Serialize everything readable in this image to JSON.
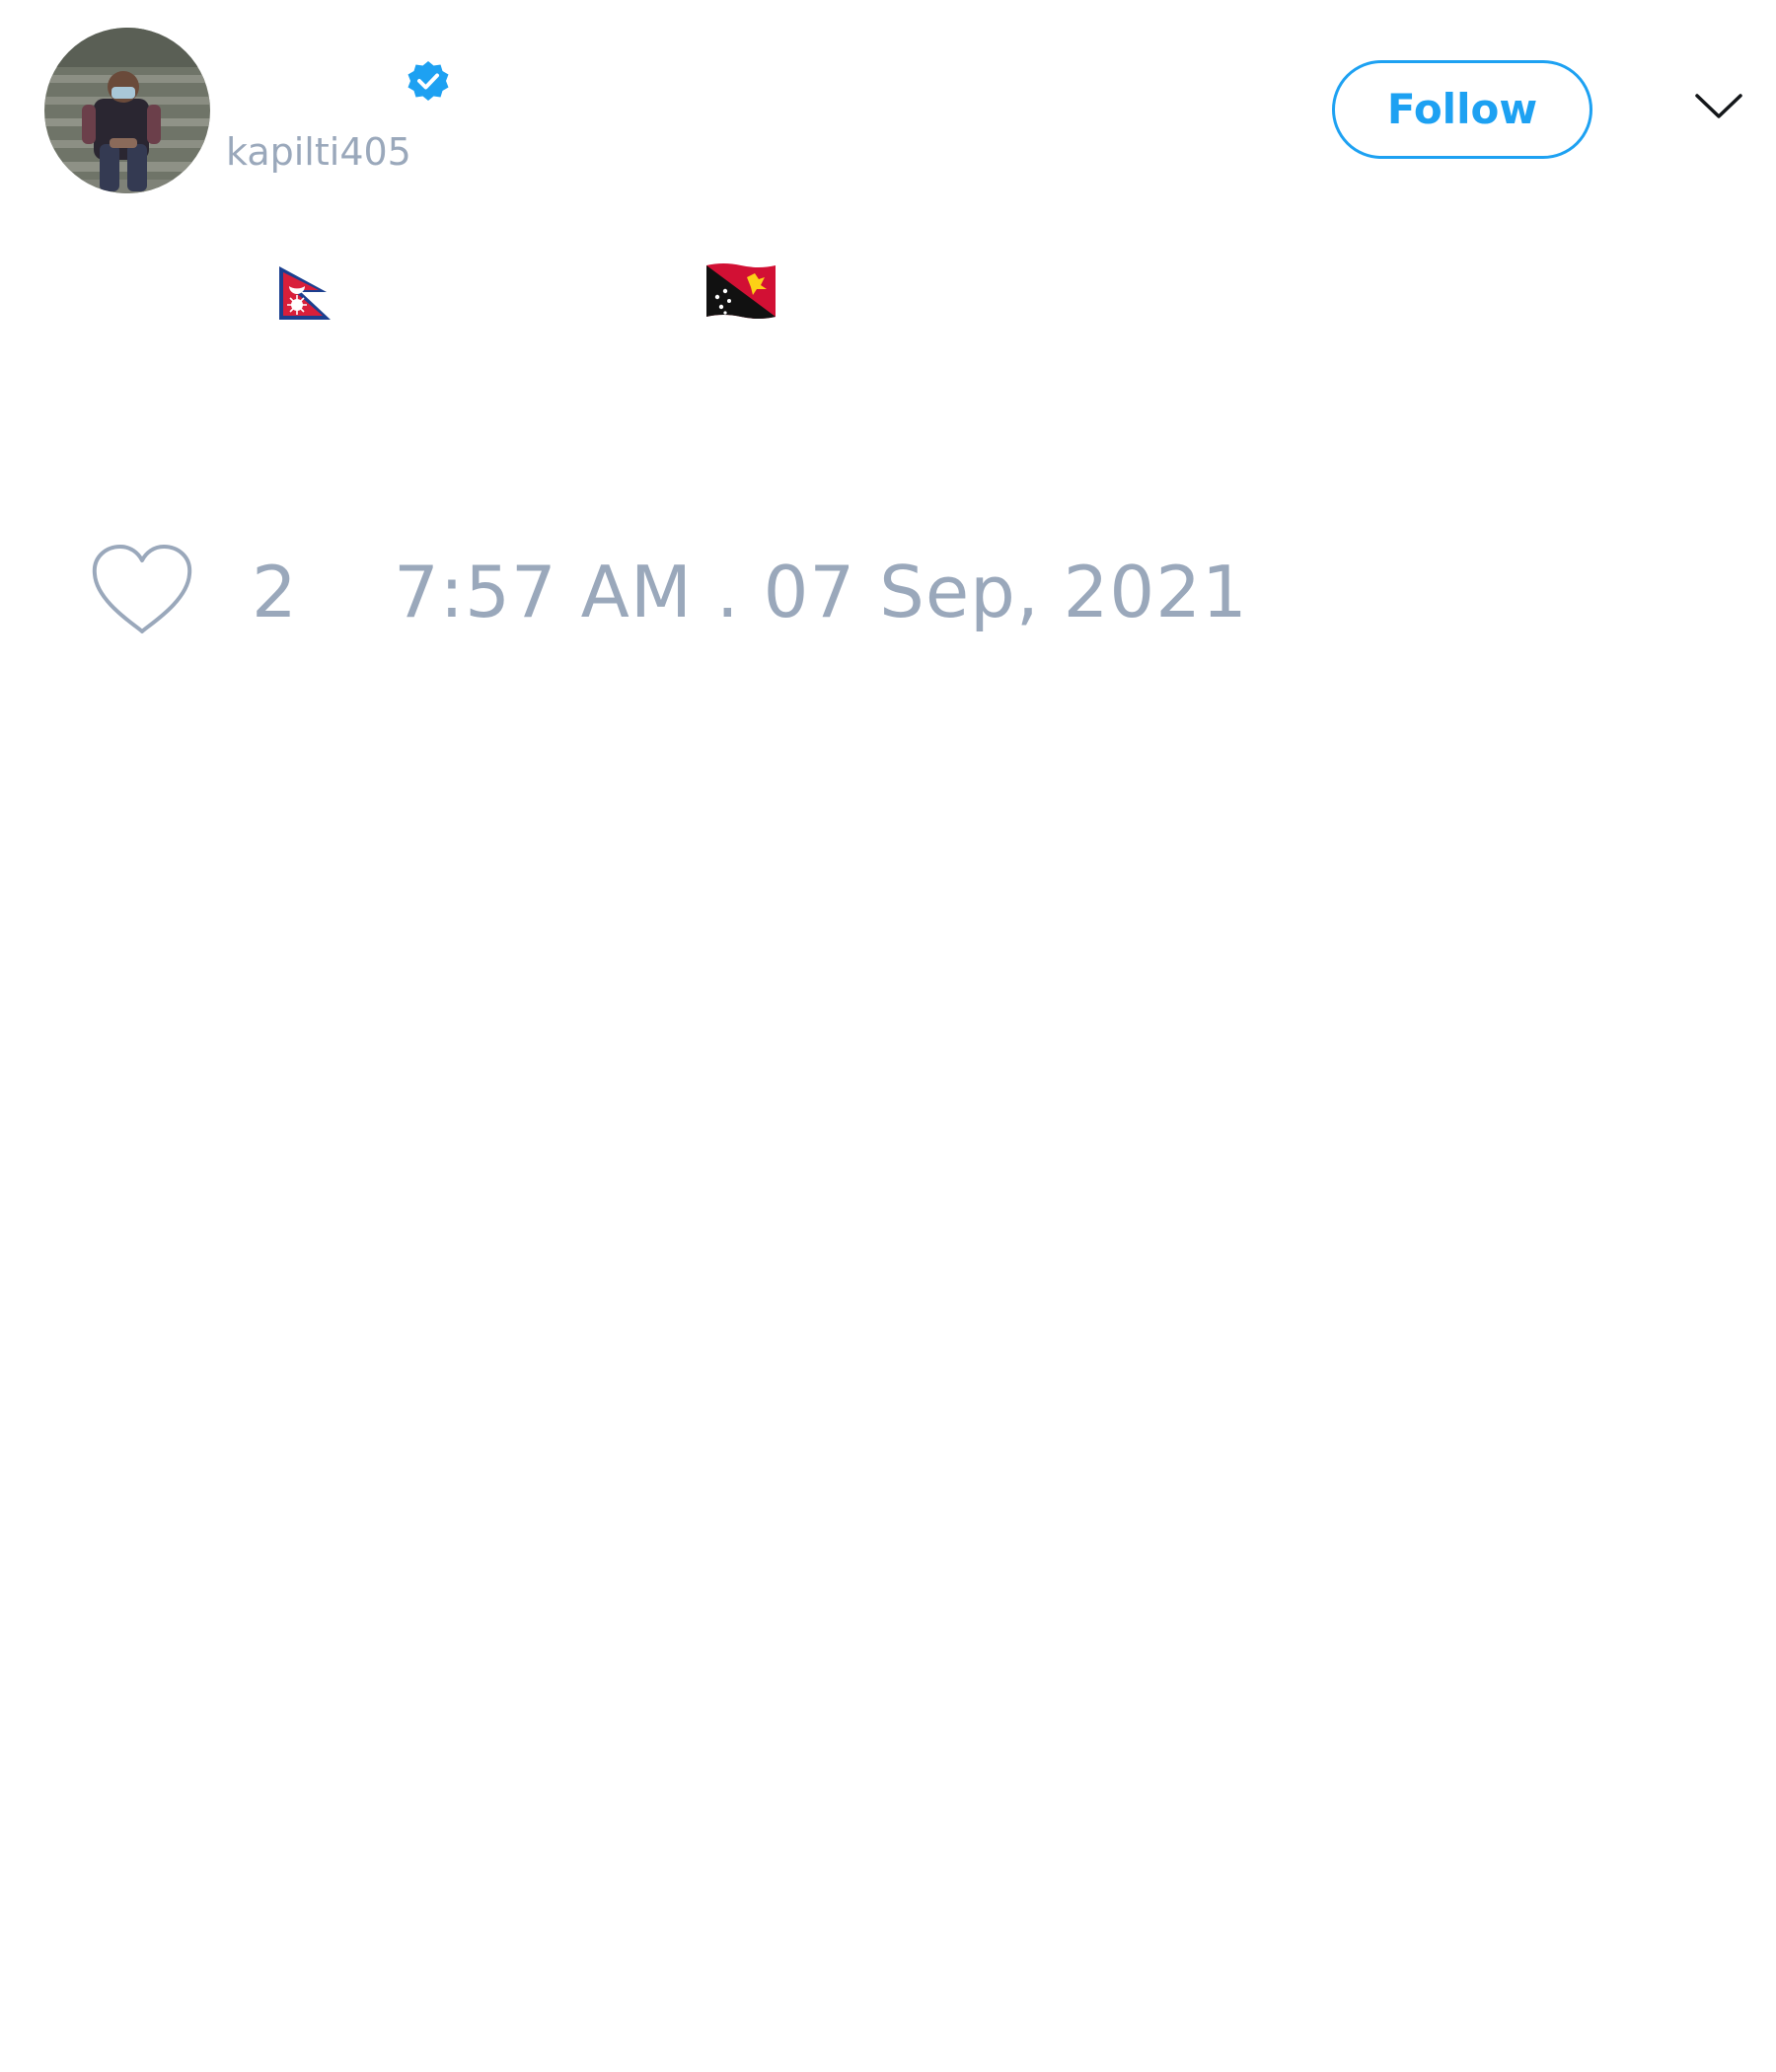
{
  "tweet": {
    "author": {
      "display_name": "",
      "username": "kapilti405",
      "verified": true,
      "avatar_icon": "user-avatar-photo"
    },
    "actions": {
      "follow_label": "Follow",
      "menu_icon": "chevron-down-icon"
    },
    "content": {
      "text": "",
      "emojis": [
        "flag-nepal",
        "flag-papua-new-guinea"
      ]
    },
    "meta": {
      "like_icon": "heart-outline-icon",
      "like_count": "2",
      "timestamp": "7:57 AM . 07 Sep, 2021"
    }
  },
  "colors": {
    "accent": "#1da1f2",
    "muted_text": "#9aa8bb",
    "background": "#ffffff",
    "verified_badge": "#1da1f2"
  }
}
